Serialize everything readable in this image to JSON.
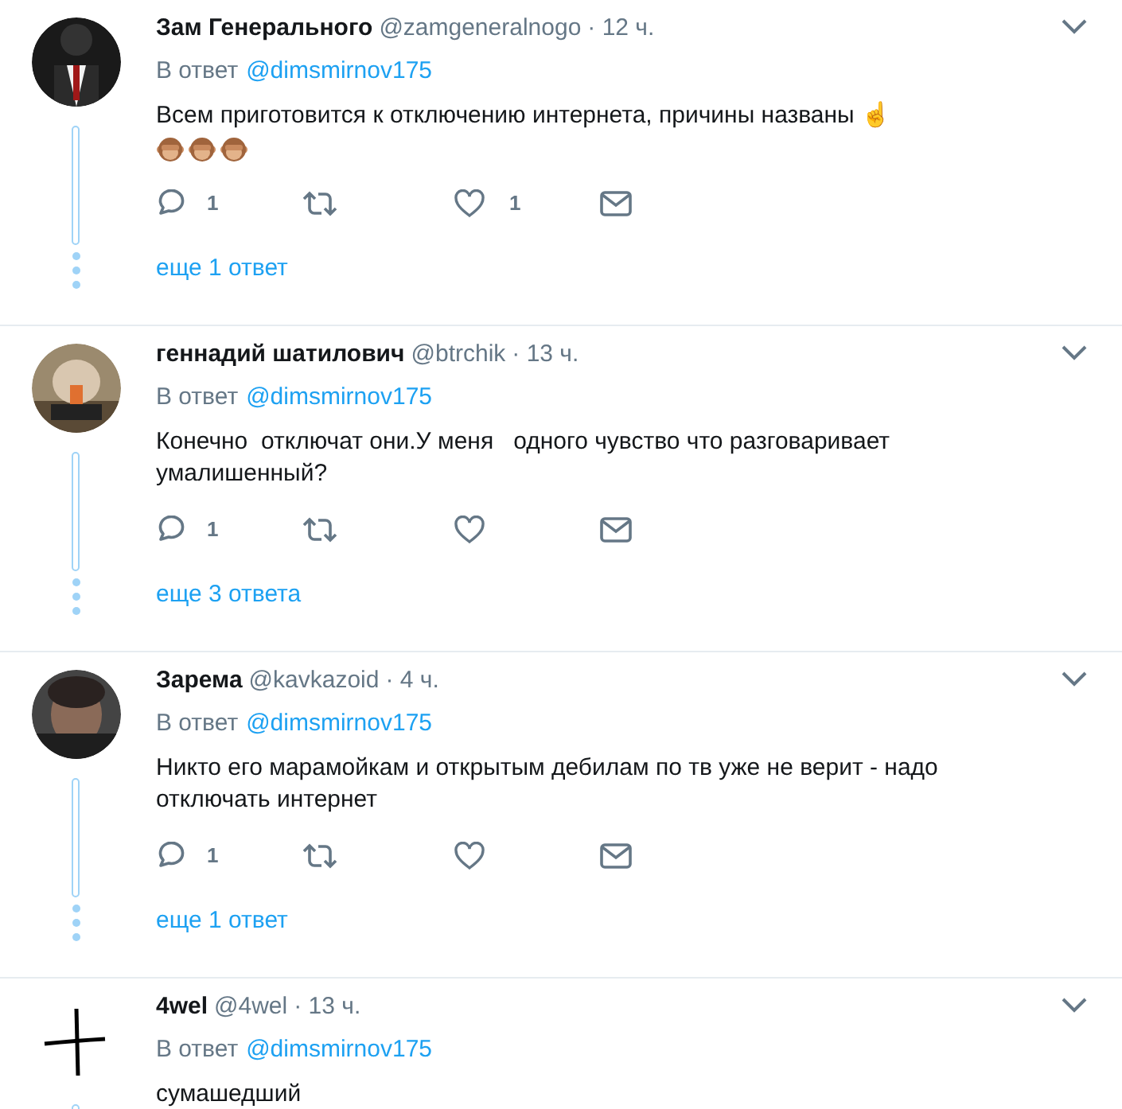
{
  "tweets": [
    {
      "name": "Зам Генерального",
      "handle": "@zamgeneralnogo",
      "time": "· 12 ч.",
      "reply_label": "В ответ",
      "reply_to": "@dimsmirnov175",
      "text": "Всем приготовится к отключению интернета, причины названы ☝",
      "emoji_row": true,
      "reply_count": "1",
      "like_count": "1",
      "more": "еще 1 ответ"
    },
    {
      "name": "геннадий шатилович",
      "handle": "@btrchik",
      "time": "· 13 ч.",
      "reply_label": "В ответ",
      "reply_to": "@dimsmirnov175",
      "text": "Конечно  отключат они.У меня   одного чувство что разговаривает умалишенный?",
      "emoji_row": false,
      "reply_count": "1",
      "more": "еще 3 ответа"
    },
    {
      "name": "Зарема",
      "handle": "@kavkazoid",
      "time": "· 4 ч.",
      "reply_label": "В ответ",
      "reply_to": "@dimsmirnov175",
      "text": "Никто его марамойкам и открытым дебилам по тв уже не верит - надо отключать интернет",
      "emoji_row": false,
      "reply_count": "1",
      "more": "еще 1 ответ"
    },
    {
      "name": "4wel",
      "handle": "@4wel",
      "time": "· 13 ч.",
      "reply_label": "В ответ",
      "reply_to": "@dimsmirnov175",
      "text": "сумашедший",
      "emoji_row": false
    }
  ]
}
